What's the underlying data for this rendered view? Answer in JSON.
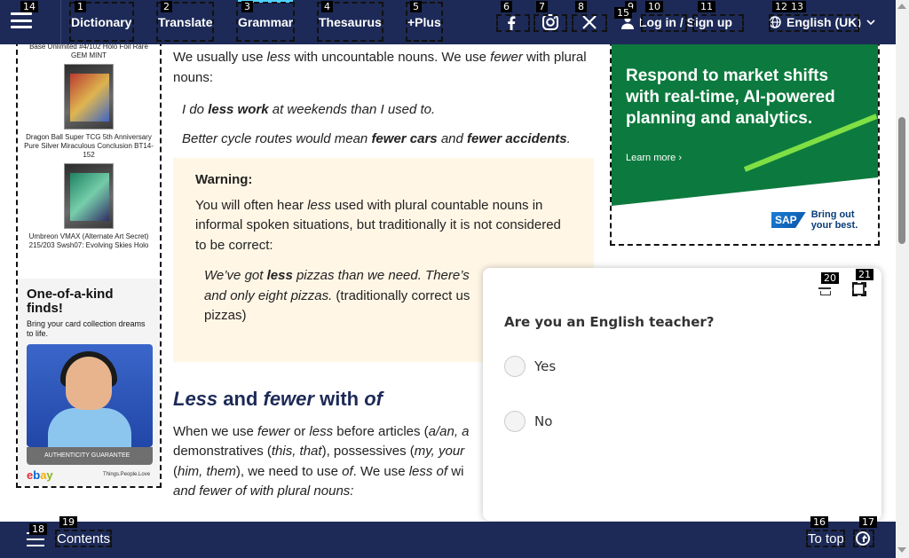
{
  "nav": {
    "items": [
      {
        "label": "Dictionary"
      },
      {
        "label": "Translate"
      },
      {
        "label": "Grammar"
      },
      {
        "label": "Thesaurus"
      },
      {
        "label": "+Plus"
      }
    ],
    "social": [
      "facebook-icon",
      "instagram-icon",
      "x-icon"
    ],
    "login_label": "Log in / Sign up",
    "language_label": "English (UK)"
  },
  "left_ad": {
    "caption1": "Base Unlimited #4/102 Holo Foil Rare GEM MINT",
    "caption2": "Dragon Ball Super TCG 5th Anniversary Pure Silver Miraculous Conclusion BT14-152",
    "caption3": "Umbreon VMAX (Alternate Art Secret) 215/203 Swsh07: Evolving Skies Holo",
    "ebay_headline": "One-of-a-kind finds!",
    "ebay_sub": "Bring your card collection dreams to life.",
    "badge": "AUTHENTICITY GUARANTEE",
    "tagline": "Things.People.Love"
  },
  "main": {
    "intro_pre": "We usually use ",
    "intro_less": "less",
    "intro_mid": " with uncountable nouns. We use ",
    "intro_fewer": "fewer",
    "intro_post": " with plural nouns:",
    "ex1_pre": "I do ",
    "ex1_bold": "less work",
    "ex1_post": " at weekends than I used to.",
    "ex2_pre": "Better cycle routes would mean ",
    "ex2_bold1": "fewer cars",
    "ex2_mid": " and ",
    "ex2_bold2": "fewer accidents",
    "ex2_post": ".",
    "warning_title": "Warning:",
    "warning_pre": "You will often hear ",
    "warning_less": "less",
    "warning_post": " used with plural countable nouns in informal spoken situations, but traditionally it is not considered to be correct:",
    "warn_ex_pre": "We’ve got ",
    "warn_ex_bold": "less",
    "warn_ex_mid": " pizzas than we need. There’s ",
    "warn_ex_tail": "and only eight pizzas.",
    "warn_ex_note": " (traditionally correct us",
    "warn_ex_note2": "pizzas)",
    "heading_less": "Less",
    "heading_and": " and ",
    "heading_fewer": "fewer",
    "heading_with": " with ",
    "heading_of": "of",
    "body2_l1_pre": "When we use ",
    "body2_fewer": "fewer",
    "body2_or": " or ",
    "body2_less": "less",
    "body2_l1_post": " before articles (",
    "body2_articles": "a/an, a",
    "body2_l2_pre": "demonstratives (",
    "body2_demo": "this, that",
    "body2_l2_mid": "), possessives (",
    "body2_poss": "my, your",
    "body2_l3_pre": "(",
    "body2_pron": "him, them",
    "body2_l3_mid": "), we need to use ",
    "body2_of": "of",
    "body2_l3_post": ". We use ",
    "body2_lessof": "less of",
    "body2_l3_end": " wi",
    "body2_l4": "and fewer of with plural nouns:"
  },
  "right_ad": {
    "headline": "Respond to market shifts with real-time, AI-powered planning and analytics.",
    "learn_more": "Learn more",
    "brand": "SAP",
    "brand_tag": "Bring out your best."
  },
  "survey": {
    "question": "Are you an English teacher?",
    "options": [
      "Yes",
      "No"
    ]
  },
  "bottom": {
    "contents_label": "Contents",
    "top_label": "To top"
  },
  "markers": [
    "1",
    "2",
    "3",
    "4",
    "5",
    "6",
    "7",
    "8",
    "9",
    "10",
    "11",
    "12",
    "13",
    "14",
    "15",
    "16",
    "17",
    "18",
    "19",
    "20",
    "21"
  ],
  "colors": {
    "nav_bg": "#1d2a57",
    "accent": "#4fd1ff",
    "warning_bg": "#fff6e6",
    "ad_green": "#0c7a3e"
  }
}
